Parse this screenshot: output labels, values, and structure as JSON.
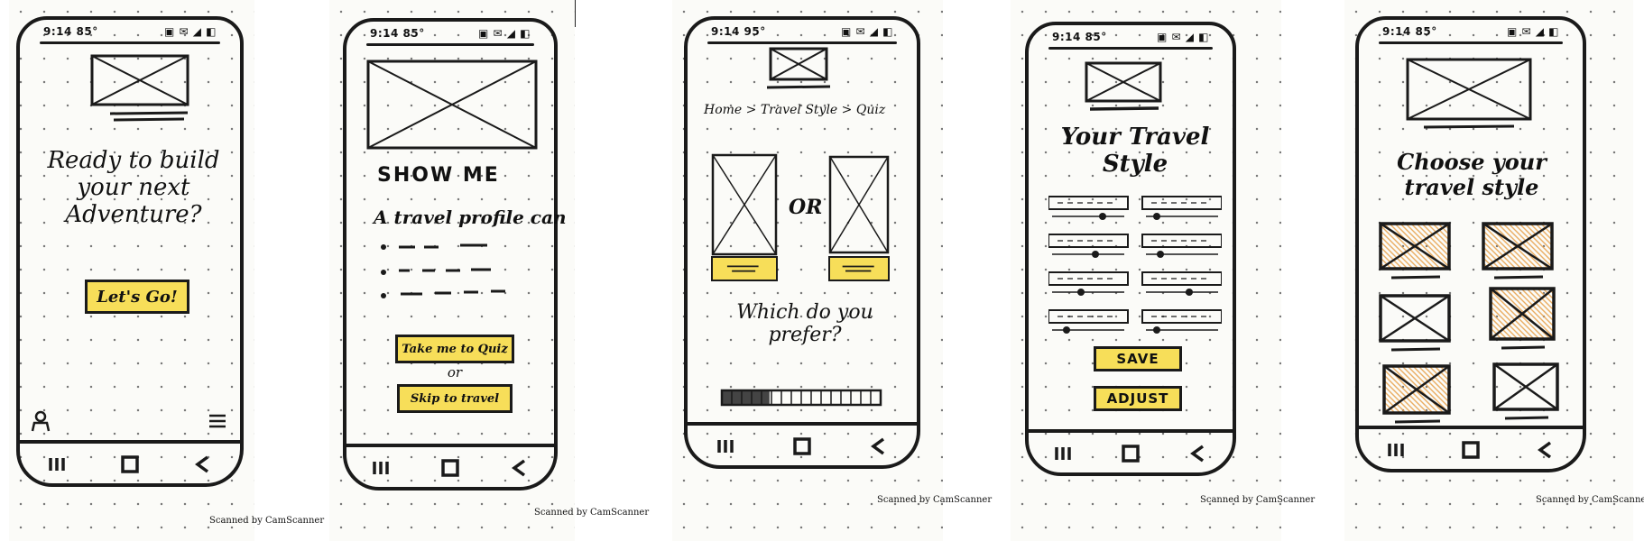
{
  "screens": [
    {
      "status": {
        "time": "9:14",
        "info": "85°",
        "icons": "▣ ✉ ◢ ◧"
      },
      "headline": [
        "Ready to build",
        "your next",
        "Adventure?"
      ],
      "primary_button": "Let's Go!",
      "footer": "Scanned by CamScanner"
    },
    {
      "status": {
        "time": "9:14",
        "info": "85°",
        "icons": "▣ ✉ ◢ ◧"
      },
      "section_title": "SHOW ME",
      "subtitle": "A travel profile can",
      "button_quiz": "Take me to Quiz",
      "or_label": "or",
      "button_skip": "Skip to travel",
      "footer": "Scanned by CamScanner"
    },
    {
      "status": {
        "time": "9:14",
        "info": "95°",
        "icons": "▣ ✉ ◢ ◧"
      },
      "breadcrumb": "Home > Travel Style > Quiz",
      "or_label": "OR",
      "question": [
        "Which do you",
        "prefer?"
      ],
      "progress": 0.3,
      "footer": "Scanned by CamScanner"
    },
    {
      "status": {
        "time": "9:14",
        "info": "85°",
        "icons": "▣ ✉ ◢ ◧"
      },
      "title": [
        "Your Travel",
        "Style"
      ],
      "save_button": "SAVE",
      "adjust_button": "ADJUST",
      "footer": "Scanned by CamScanner"
    },
    {
      "status": {
        "time": "9:14",
        "info": "85°",
        "icons": "▣ ✉ ◢ ◧"
      },
      "title": [
        "Choose your",
        "travel style"
      ],
      "footer": "Scanned by CamScanner"
    }
  ],
  "colors": {
    "highlight": "#f7de59",
    "orange_scribble": "#e8a04a",
    "ink": "#1a1a1a"
  },
  "icons": {
    "nav": [
      "recent-apps-icon",
      "home-icon",
      "back-icon"
    ],
    "screen1_bottom": [
      "profile-icon",
      "menu-icon"
    ]
  }
}
